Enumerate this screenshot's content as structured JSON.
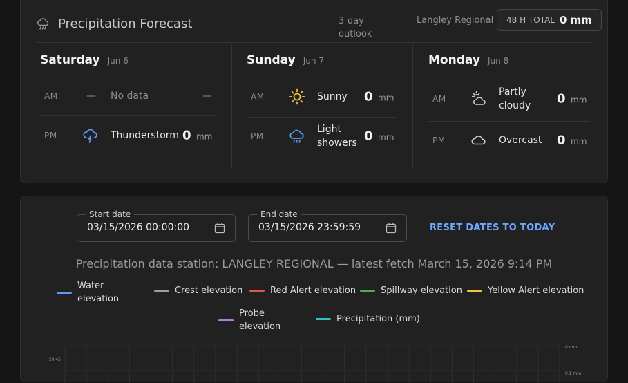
{
  "forecast": {
    "title": "Precipitation Forecast",
    "outlook": "3-day outlook",
    "separator": "·",
    "station": "Langley Regional",
    "total_label": "48 H TOTAL",
    "total_value": "0 mm",
    "days": [
      {
        "name": "Saturday",
        "date": "Jun 6",
        "periods": [
          {
            "label": "AM",
            "icon": "dash",
            "condition": "No data",
            "value": "",
            "unit": "",
            "no_data_dash": "—"
          },
          {
            "label": "PM",
            "icon": "thunderstorm-icon",
            "condition": "Thunderstorm",
            "value": "0",
            "unit": "mm"
          }
        ]
      },
      {
        "name": "Sunday",
        "date": "Jun 7",
        "periods": [
          {
            "label": "AM",
            "icon": "sun-icon",
            "condition": "Sunny",
            "value": "0",
            "unit": "mm"
          },
          {
            "label": "PM",
            "icon": "light-showers-icon",
            "condition": "Light showers",
            "value": "0",
            "unit": "mm"
          }
        ]
      },
      {
        "name": "Monday",
        "date": "Jun 8",
        "periods": [
          {
            "label": "AM",
            "icon": "partly-cloudy-icon",
            "condition": "Partly cloudy",
            "value": "0",
            "unit": "mm"
          },
          {
            "label": "PM",
            "icon": "overcast-icon",
            "condition": "Overcast",
            "value": "0",
            "unit": "mm"
          }
        ]
      }
    ]
  },
  "filters": {
    "start_label": "Start date",
    "start_value": "03/15/2026 00:00:00",
    "end_label": "End date",
    "end_value": "03/15/2026 23:59:59",
    "reset_label": "RESET DATES TO TODAY"
  },
  "station_line": "Precipitation data station: LANGLEY REGIONAL — latest fetch March 15, 2026 9:14 PM",
  "colors": {
    "water": "#5b9cf0",
    "crest": "#9e9e9e",
    "red_alert": "#e05555",
    "spillway": "#4caf50",
    "yellow_alert": "#f5c342",
    "probe": "#b57bdc",
    "precipitation": "#2ec4c4",
    "sun": "#f5c342",
    "rain": "#5b9cf0"
  },
  "chart_data": {
    "type": "line",
    "title": "",
    "series": [
      {
        "name": "Water elevation",
        "color": "#5b9cf0",
        "values": []
      },
      {
        "name": "Crest elevation",
        "color": "#9e9e9e",
        "values": []
      },
      {
        "name": "Red Alert elevation",
        "color": "#e05555",
        "values": []
      },
      {
        "name": "Spillway elevation",
        "color": "#4caf50",
        "values": []
      },
      {
        "name": "Yellow Alert elevation",
        "color": "#f5c342",
        "values": []
      },
      {
        "name": "Probe elevation",
        "color": "#b57bdc",
        "values": []
      },
      {
        "name": "Precipitation (mm)",
        "color": "#2ec4c4",
        "values": []
      }
    ],
    "y_left_tick": "59.45",
    "y_right_ticks": [
      "0 mm",
      "0.1 mm"
    ],
    "grid": true,
    "legend_position": "top"
  }
}
